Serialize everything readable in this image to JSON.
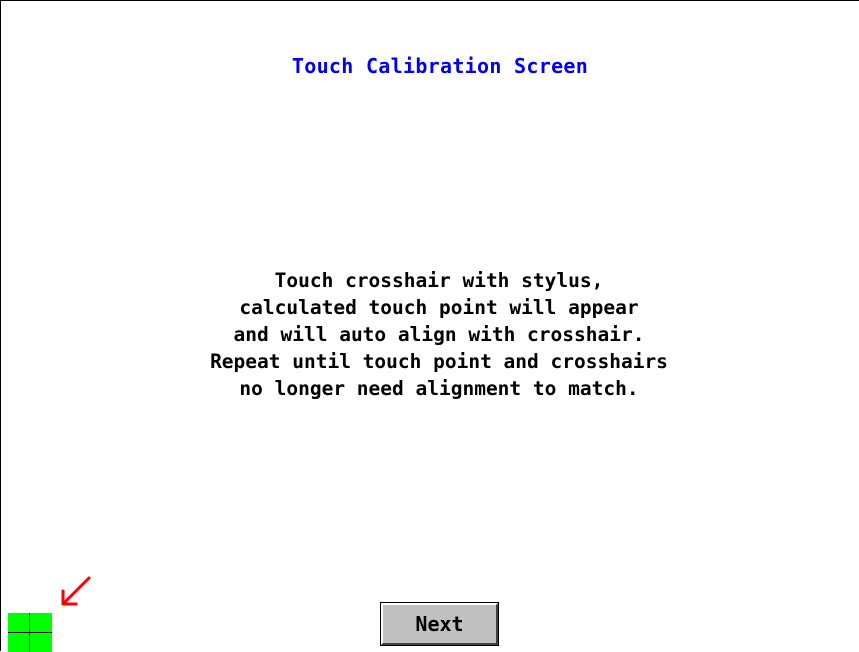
{
  "screen": {
    "title": "Touch Calibration Screen",
    "instructions": [
      "Touch crosshair with stylus,",
      "calculated touch point will appear",
      "and will auto align with crosshair.",
      "Repeat until touch point and crosshairs",
      "no longer need alignment to match."
    ],
    "next_label": "Next"
  },
  "icons": {
    "crosshair": "crosshair-target-icon",
    "arrow": "arrow-down-left-icon"
  },
  "colors": {
    "title": "#0000ff",
    "crosshair_fill": "#00ff00",
    "arrow": "#ff0000",
    "button_face": "#c0c0c0",
    "background": "#ffffff"
  }
}
